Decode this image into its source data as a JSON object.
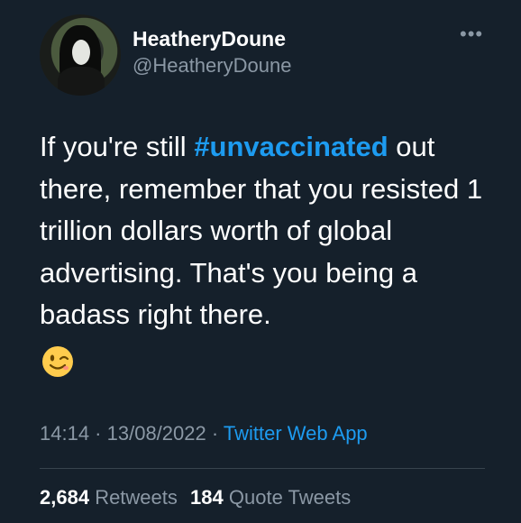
{
  "user": {
    "display_name": "HeatheryDoune",
    "handle": "@HeatheryDoune"
  },
  "more_icon": "more-horizontal-icon",
  "tweet": {
    "text_before": "If you're still ",
    "hashtag": "#unvaccinated",
    "text_after": " out there, remember that you resisted 1 trillion dollars worth of global advertising. That's you being a badass right there.",
    "emoji": "winking-face-emoji"
  },
  "meta": {
    "time": "14:14",
    "sep1": " · ",
    "date": "13/08/2022",
    "sep2": " · ",
    "source": "Twitter Web App"
  },
  "stats": {
    "retweets_count": "2,684",
    "retweets_label": "Retweets",
    "quotes_count": "184",
    "quotes_label": "Quote Tweets"
  },
  "colors": {
    "background": "#15202b",
    "accent": "#1d9bf0",
    "secondary_text": "#8b98a5"
  }
}
